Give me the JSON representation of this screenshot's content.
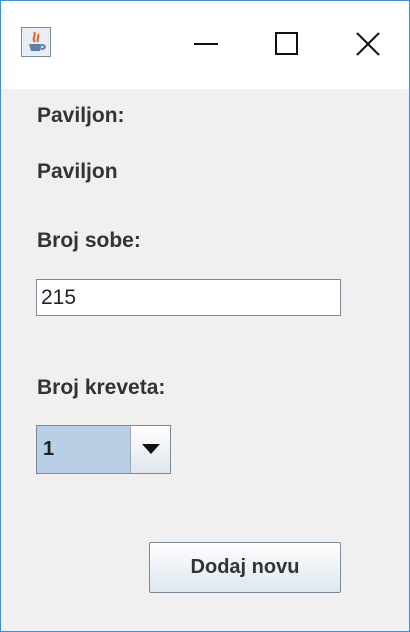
{
  "window": {
    "app_icon": "java-cup-icon",
    "controls": [
      "minimize-icon",
      "maximize-icon",
      "close-icon"
    ]
  },
  "form": {
    "paviljon_label": "Paviljon:",
    "paviljon_value": "Paviljon",
    "broj_sobe_label": "Broj sobe:",
    "broj_sobe_value": "215",
    "broj_kreveta_label": "Broj kreveta:",
    "broj_kreveta_value": "1",
    "submit_label": "Dodaj novu"
  },
  "colors": {
    "window_border": "#3c8ed6",
    "background": "#f0f0f0",
    "combo_selection": "#b8cfe5"
  }
}
